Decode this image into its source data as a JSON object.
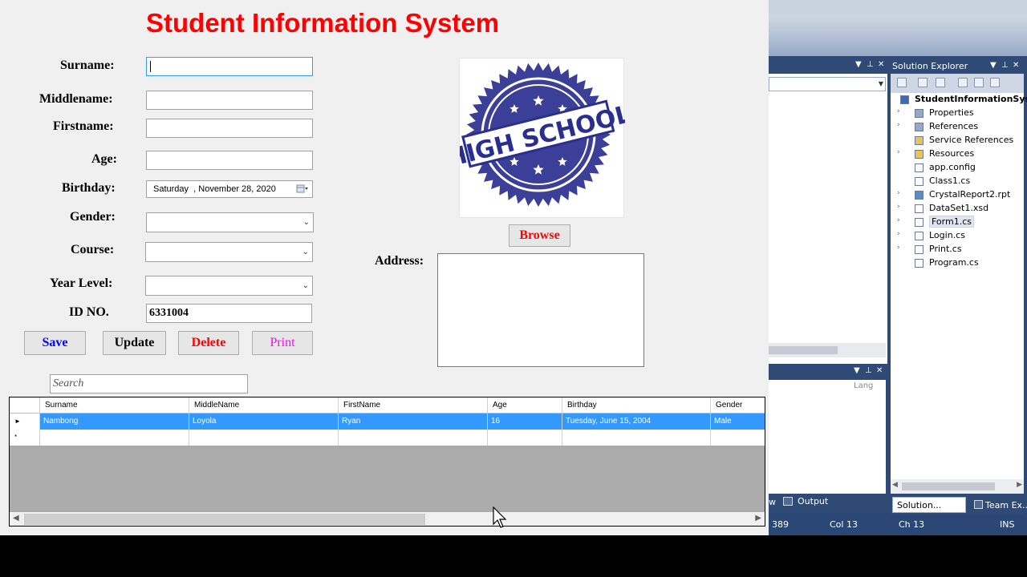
{
  "app": {
    "title": "Student Information System"
  },
  "form": {
    "surname_label": "Surname:",
    "middlename_label": "Middlename:",
    "firstname_label": "Firstname:",
    "age_label": "Age:",
    "birthday_label": "Birthday:",
    "gender_label": "Gender:",
    "course_label": "Course:",
    "year_level_label": "Year Level:",
    "id_label": "ID NO.",
    "address_label": "Address:",
    "surname_value": "",
    "middlename_value": "",
    "firstname_value": "",
    "age_value": "",
    "birthday_value": "Saturday  , November 28, 2020",
    "gender_value": "",
    "course_value": "",
    "year_level_value": "",
    "id_value": "6331004",
    "address_value": "",
    "photo_stamp_text": "HIGH SCHOOL"
  },
  "buttons": {
    "browse": "Browse",
    "save": "Save",
    "update": "Update",
    "delete": "Delete",
    "print": "Print"
  },
  "colors": {
    "title": "#ff0000",
    "save": "#0000ff",
    "update": "#000000",
    "delete": "#ff0000",
    "print": "#ff00ff",
    "browse": "#ff0000",
    "stamp": "#2a2f8f",
    "selection": "#3399ff"
  },
  "search": {
    "placeholder": "Search"
  },
  "grid": {
    "columns": [
      "Surname",
      "MiddleName",
      "FirstName",
      "Age",
      "Birthday",
      "Gender"
    ],
    "rows": [
      [
        "Nambong",
        "Loyola",
        "Ryan",
        "16",
        "Tuesday, June 15, 2004",
        "Male"
      ]
    ],
    "selected_row_marker": "►",
    "new_row_marker": "*"
  },
  "vs": {
    "solution_explorer": {
      "title": "Solution Explorer",
      "items": [
        {
          "label": "StudentInformationSyste",
          "icon": "csproj-icon"
        },
        {
          "label": "Properties",
          "icon": "properties-icon"
        },
        {
          "label": "References",
          "icon": "references-icon"
        },
        {
          "label": "Service References",
          "icon": "folder-icon"
        },
        {
          "label": "Resources",
          "icon": "folder-icon"
        },
        {
          "label": "app.config",
          "icon": "config-icon"
        },
        {
          "label": "Class1.cs",
          "icon": "cs-file-icon"
        },
        {
          "label": "CrystalReport2.rpt",
          "icon": "report-icon"
        },
        {
          "label": "DataSet1.xsd",
          "icon": "xsd-icon"
        },
        {
          "label": "Form1.cs",
          "icon": "form-icon"
        },
        {
          "label": "Login.cs",
          "icon": "form-icon"
        },
        {
          "label": "Print.cs",
          "icon": "form-icon"
        },
        {
          "label": "Program.cs",
          "icon": "cs-file-icon"
        }
      ],
      "selected": "Form1.cs"
    },
    "bottom_tabs": {
      "left_fragment": "w",
      "output": "Output",
      "solution": "Solution...",
      "team": "Team Ex..."
    },
    "properties_lang": "Lang",
    "status": {
      "ln": "389",
      "col": "Col 13",
      "ch": "Ch 13",
      "mode": "INS"
    }
  }
}
